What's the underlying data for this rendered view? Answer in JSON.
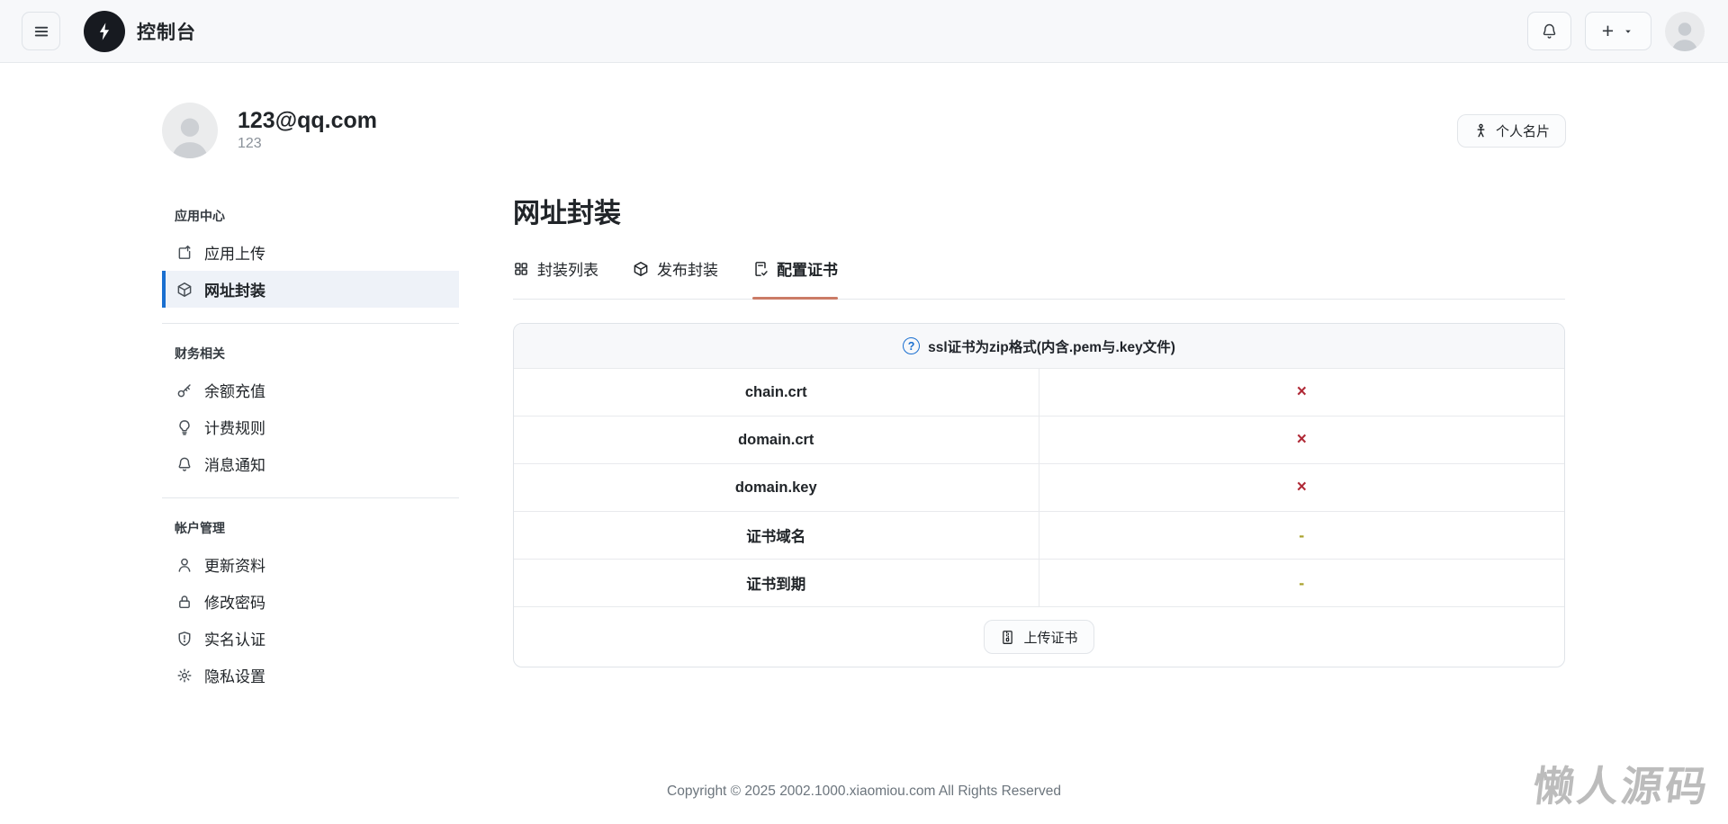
{
  "topbar": {
    "title": "控制台",
    "create_label": "+"
  },
  "profile": {
    "email": "123@qq.com",
    "username": "123",
    "card_button_label": "个人名片"
  },
  "sidebar": {
    "sections": [
      {
        "header": "应用中心",
        "items": [
          {
            "id": "app-upload",
            "icon": "box-arrow-up",
            "label": "应用上传",
            "active": false
          },
          {
            "id": "url-package",
            "icon": "cube",
            "label": "网址封装",
            "active": true
          }
        ]
      },
      {
        "header": "财务相关",
        "items": [
          {
            "id": "balance-recharge",
            "icon": "key",
            "label": "余额充值",
            "active": false
          },
          {
            "id": "billing-rules",
            "icon": "lightbulb",
            "label": "计费规则",
            "active": false
          },
          {
            "id": "notifications",
            "icon": "bell",
            "label": "消息通知",
            "active": false
          }
        ]
      },
      {
        "header": "帐户管理",
        "items": [
          {
            "id": "update-profile",
            "icon": "person",
            "label": "更新资料",
            "active": false
          },
          {
            "id": "change-password",
            "icon": "lock",
            "label": "修改密码",
            "active": false
          },
          {
            "id": "real-name-auth",
            "icon": "shield-exclamation",
            "label": "实名认证",
            "active": false
          },
          {
            "id": "privacy",
            "icon": "gear",
            "label": "隐私设置",
            "active": false
          }
        ]
      }
    ]
  },
  "main": {
    "title": "网址封装",
    "tabs": [
      {
        "id": "package-list",
        "icon": "grid",
        "label": "封装列表",
        "active": false
      },
      {
        "id": "publish-package",
        "icon": "cube",
        "label": "发布封装",
        "active": false
      },
      {
        "id": "configure-cert",
        "icon": "file-check",
        "label": "配置证书",
        "active": true
      }
    ],
    "cert_table": {
      "help_glyph": "?",
      "notice": "ssl证书为zip格式(内含.pem与.key文件)",
      "rows": [
        {
          "name": "chain.crt",
          "status": "×",
          "status_type": "missing"
        },
        {
          "name": "domain.crt",
          "status": "×",
          "status_type": "missing"
        },
        {
          "name": "domain.key",
          "status": "×",
          "status_type": "missing"
        },
        {
          "name": "证书域名",
          "status": "-",
          "status_type": "empty"
        },
        {
          "name": "证书到期",
          "status": "-",
          "status_type": "empty"
        }
      ],
      "upload_button_label": "上传证书"
    }
  },
  "footer": {
    "copyright": "Copyright © 2025 2002.1000.xiaomiou.com All Rights Reserved"
  },
  "watermark": {
    "text": "懒人源码"
  },
  "colors": {
    "accent_blue": "#1a6fd0",
    "tab_underline": "#cb7b66",
    "error_red": "#b02a37",
    "empty_dash": "#aaa22e",
    "watermark_gray": "#bcbcbc",
    "topbar_bg": "#f7f8fa"
  }
}
